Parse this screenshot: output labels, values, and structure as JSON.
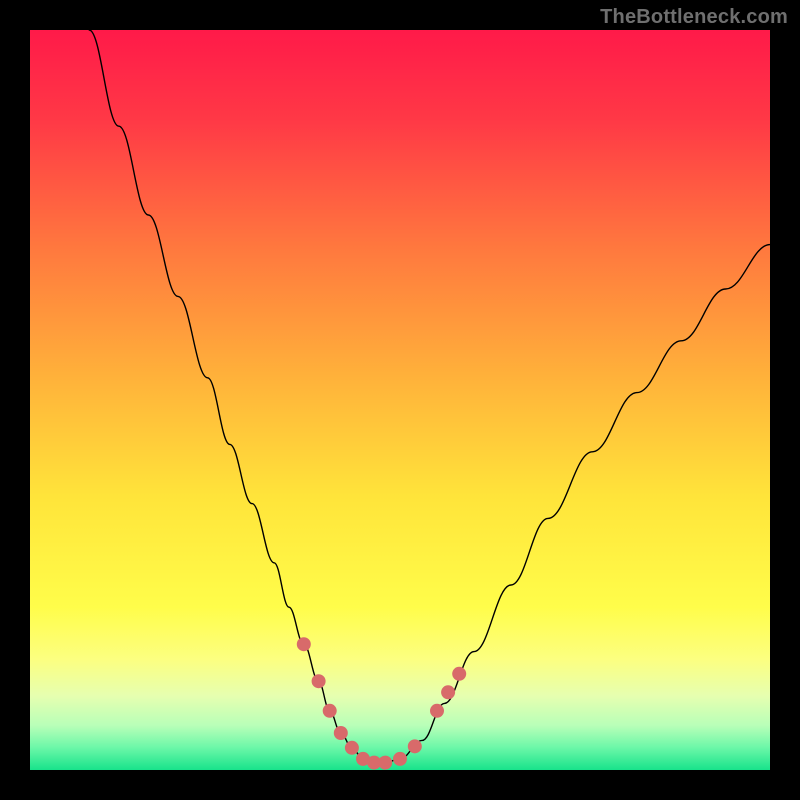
{
  "watermark": "TheBottleneck.com",
  "colors": {
    "background_top": "#ff1a49",
    "background_bottom": "#18e38b",
    "curve": "#000000",
    "dots": "#d86a6a",
    "page_bg": "#000000",
    "watermark": "#6f6f6f"
  },
  "chart_data": {
    "type": "line",
    "title": "",
    "xlabel": "",
    "ylabel": "",
    "xlim": [
      0,
      100
    ],
    "ylim": [
      0,
      100
    ],
    "x": [
      8,
      12,
      16,
      20,
      24,
      27,
      30,
      33,
      35,
      37,
      39,
      40.5,
      42,
      43.5,
      45,
      46.5,
      48,
      50,
      53,
      56,
      60,
      65,
      70,
      76,
      82,
      88,
      94,
      100
    ],
    "values": [
      100,
      87,
      75,
      64,
      53,
      44,
      36,
      28,
      22,
      17,
      12,
      8,
      5,
      3,
      1.5,
      1,
      1,
      1.5,
      4,
      9,
      16,
      25,
      34,
      43,
      51,
      58,
      65,
      71
    ],
    "highlight_points": [
      {
        "x": 37,
        "y": 17
      },
      {
        "x": 39,
        "y": 12
      },
      {
        "x": 40.5,
        "y": 8
      },
      {
        "x": 42,
        "y": 5
      },
      {
        "x": 43.5,
        "y": 3
      },
      {
        "x": 45,
        "y": 1.5
      },
      {
        "x": 46.5,
        "y": 1
      },
      {
        "x": 48,
        "y": 1
      },
      {
        "x": 50,
        "y": 1.5
      },
      {
        "x": 52,
        "y": 3.2
      },
      {
        "x": 55,
        "y": 8
      },
      {
        "x": 56.5,
        "y": 10.5
      },
      {
        "x": 58,
        "y": 13
      }
    ]
  }
}
